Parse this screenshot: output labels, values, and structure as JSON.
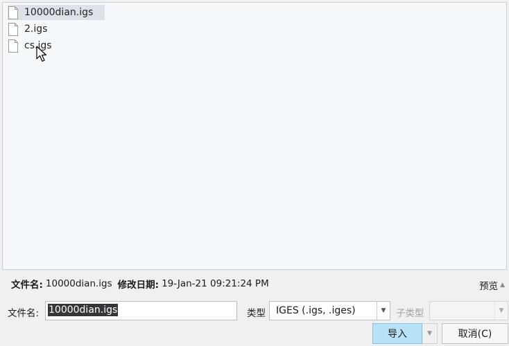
{
  "files": [
    {
      "name": "10000dian.igs",
      "selected": true,
      "icon": "file-icon"
    },
    {
      "name": "2.igs",
      "selected": false,
      "icon": "file-icon"
    },
    {
      "name": "cs.igs",
      "selected": false,
      "icon": "file-icon"
    }
  ],
  "info": {
    "filename_label": "文件名:",
    "filename_value": "10000dian.igs",
    "modified_label": "修改日期:",
    "modified_value": "19-Jan-21 09:21:24 PM",
    "preview_label": "预览"
  },
  "filename_field": {
    "label": "文件名:",
    "value": "10000dian.igs"
  },
  "type_field": {
    "label": "类型",
    "selected": "IGES (.igs, .iges)"
  },
  "subtype_field": {
    "label": "子类型",
    "selected": ""
  },
  "buttons": {
    "import_label": "导入",
    "cancel_label": "取消(C)"
  },
  "colors": {
    "list_background": "#f5f9fc",
    "selection": "#dde2e8",
    "import_button": "#b8e2f8"
  }
}
